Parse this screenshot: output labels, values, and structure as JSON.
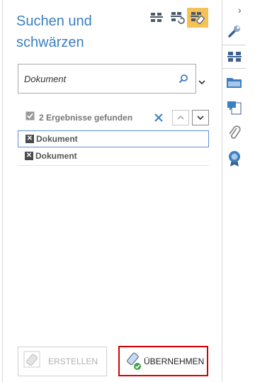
{
  "panel": {
    "title": "Suchen und schwärzen",
    "modes": [
      {
        "icon": "search-stacked-icon",
        "active": false
      },
      {
        "icon": "search-refresh-icon",
        "active": false
      },
      {
        "icon": "search-redact-icon",
        "active": true
      }
    ]
  },
  "search": {
    "value": "Dokument",
    "search_icon": "magnifier-icon",
    "dropdown_icon": "chevron-down-icon"
  },
  "results": {
    "summary": "2 Ergebnisse gefunden",
    "items": [
      {
        "label": "Dokument",
        "selected": true
      },
      {
        "label": "Dokument",
        "selected": false
      }
    ]
  },
  "actions": {
    "create_label": "ERSTELLEN",
    "apply_label": "ÜBERNEHMEN"
  },
  "sidebar": {
    "collapse_glyph": "›",
    "icons": [
      "wrench-icon",
      "binoculars-icon",
      "folder-icon",
      "comments-icon",
      "paperclip-icon",
      "badge-icon"
    ]
  },
  "colors": {
    "accent": "#3c7fc1",
    "active_mode": "#f4c257",
    "highlight_border": "#d40000"
  }
}
